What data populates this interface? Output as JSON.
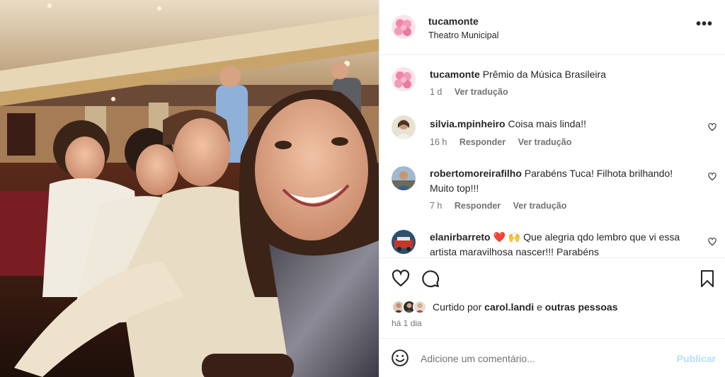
{
  "post": {
    "username": "tucamonte",
    "location": "Theatro Municipal",
    "more_label": "•••"
  },
  "caption": {
    "username": "tucamonte",
    "text": "Prêmio da Música Brasileira",
    "time": "1 d",
    "translate": "Ver tradução"
  },
  "comments": [
    {
      "username": "silvia.mpinheiro",
      "text": "Coisa mais linda!!",
      "time": "16 h",
      "reply": "Responder",
      "translate": "Ver tradução"
    },
    {
      "username": "robertomoreirafilho",
      "text": "Parabéns Tuca! Filhota brilhando! Muito top!!!",
      "time": "7 h",
      "reply": "Responder",
      "translate": "Ver tradução"
    },
    {
      "username": "elanirbarreto",
      "text": "Que alegria qdo lembro que vi essa artista maravilhosa nascer!!! Parabéns",
      "emojis": "❤️ 🙌"
    }
  ],
  "likes": {
    "prefix": "Curtido por",
    "user": "carol.landi",
    "joiner": "e",
    "others": "outras pessoas",
    "ago": "há 1 dia"
  },
  "add_comment": {
    "placeholder": "Adicione um comentário...",
    "post_label": "Publicar"
  },
  "icons": {
    "more": "more-horizontal-icon",
    "like": "heart-icon",
    "comment": "comment-bubble-icon",
    "save": "bookmark-icon",
    "emoji": "emoji-smile-icon"
  },
  "colors": {
    "text": "#262626",
    "secondary": "#737373",
    "divider": "#efefef",
    "publish_disabled": "#b2dffc",
    "heart_red": "#ed4956"
  }
}
